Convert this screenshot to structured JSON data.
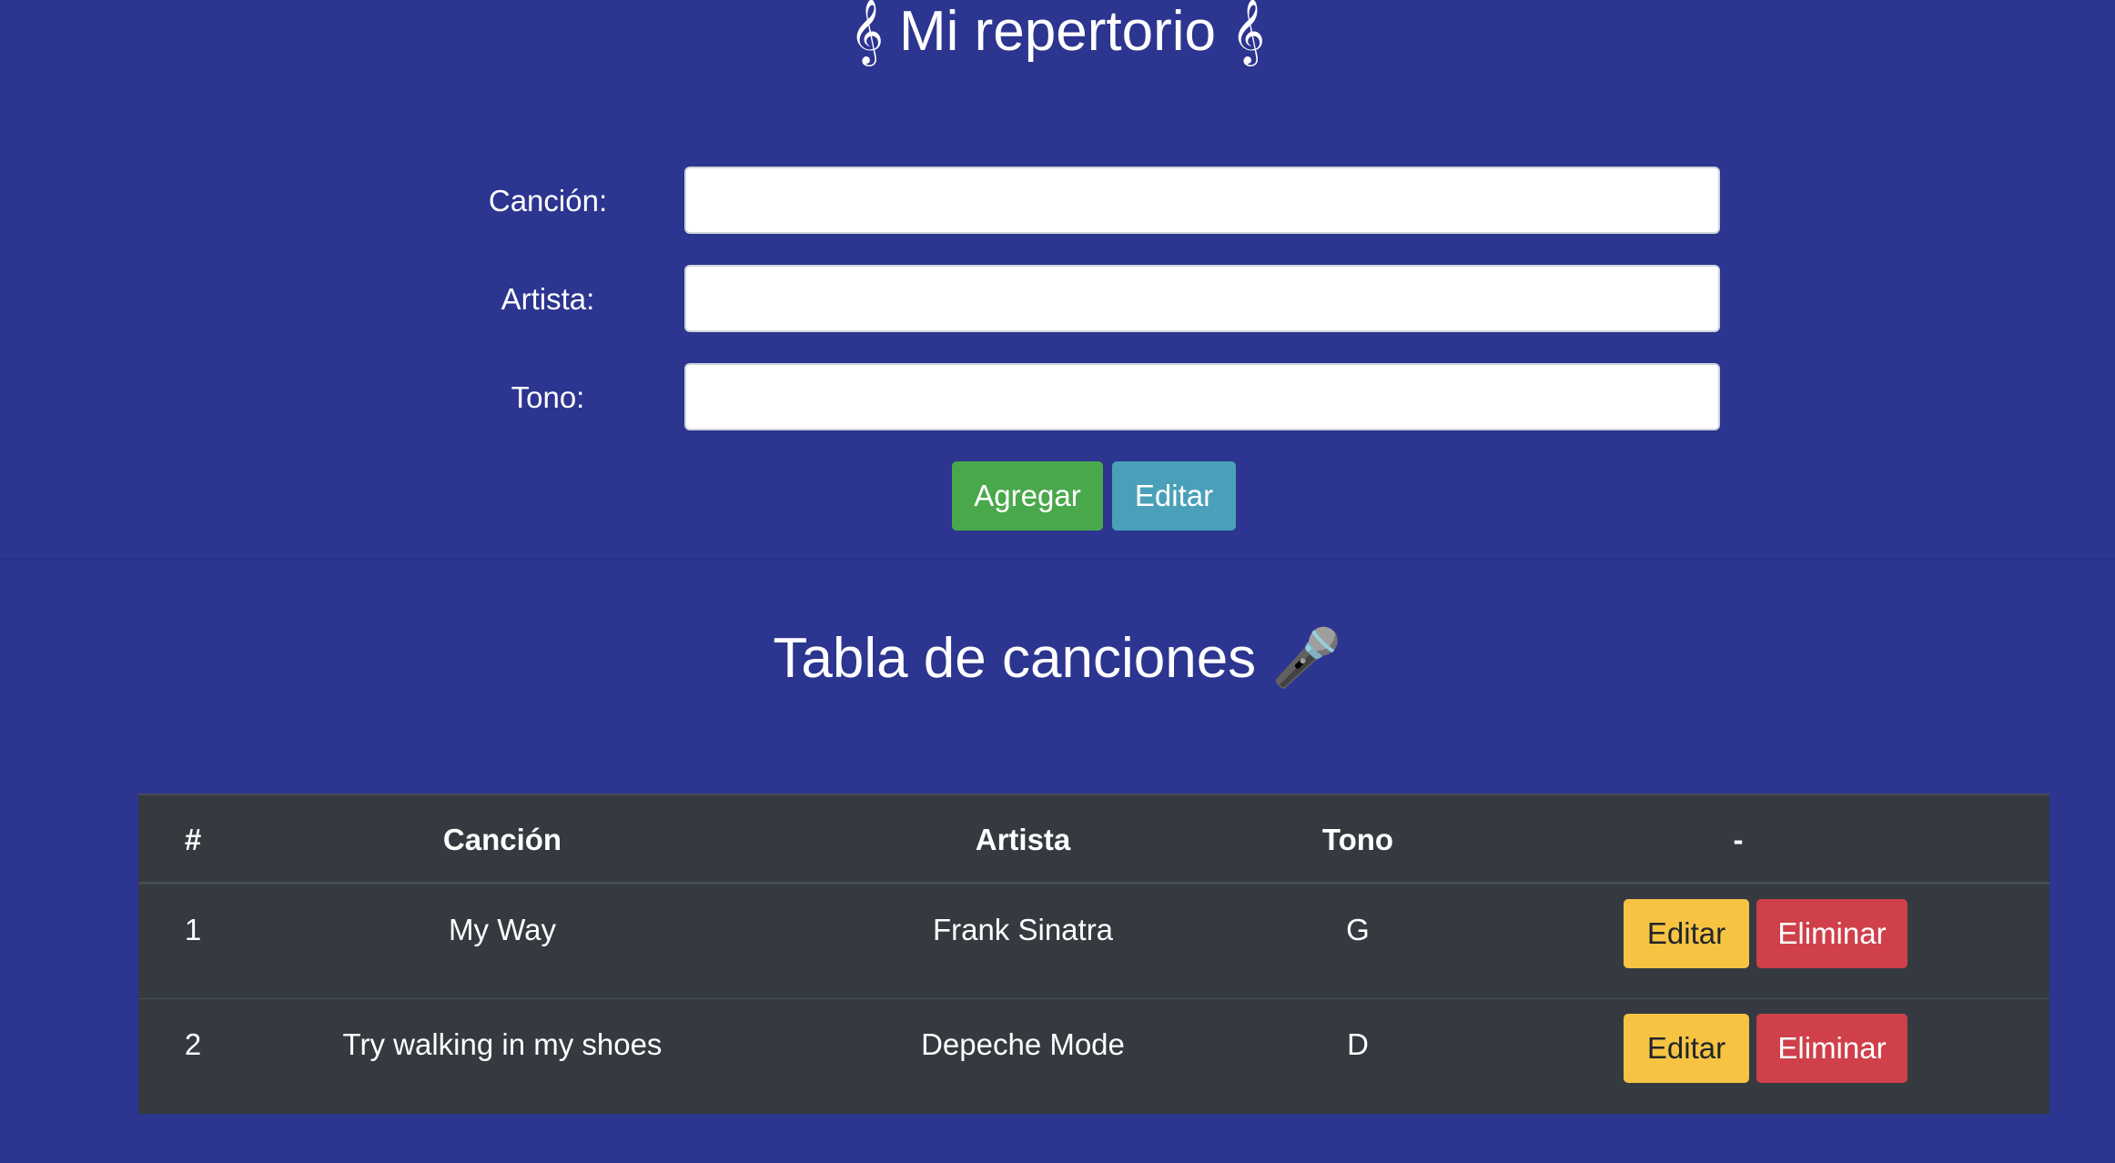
{
  "header": {
    "title": "𝄞 Mi repertorio 𝄞"
  },
  "form": {
    "song_label": "Canción:",
    "artist_label": "Artista:",
    "tone_label": "Tono:",
    "song_value": "",
    "artist_value": "",
    "tone_value": "",
    "add_label": "Agregar",
    "edit_label": "Editar"
  },
  "table_section": {
    "title": "Tabla de canciones",
    "title_icon": "🎤"
  },
  "table": {
    "headers": [
      "#",
      "Canción",
      "Artista",
      "Tono",
      "-"
    ],
    "rows": [
      {
        "num": "1",
        "song": "My Way",
        "artist": "Frank Sinatra",
        "tone": "G",
        "edit_label": "Editar",
        "delete_label": "Eliminar"
      },
      {
        "num": "2",
        "song": "Try walking in my shoes",
        "artist": "Depeche Mode",
        "tone": "D",
        "edit_label": "Editar",
        "delete_label": "Eliminar"
      }
    ]
  },
  "colors": {
    "background": "#2c358f",
    "table_background": "#343a40",
    "success": "#4aa84c",
    "info": "#4aa0b8",
    "warning": "#f6c343",
    "danger": "#cf404a"
  }
}
